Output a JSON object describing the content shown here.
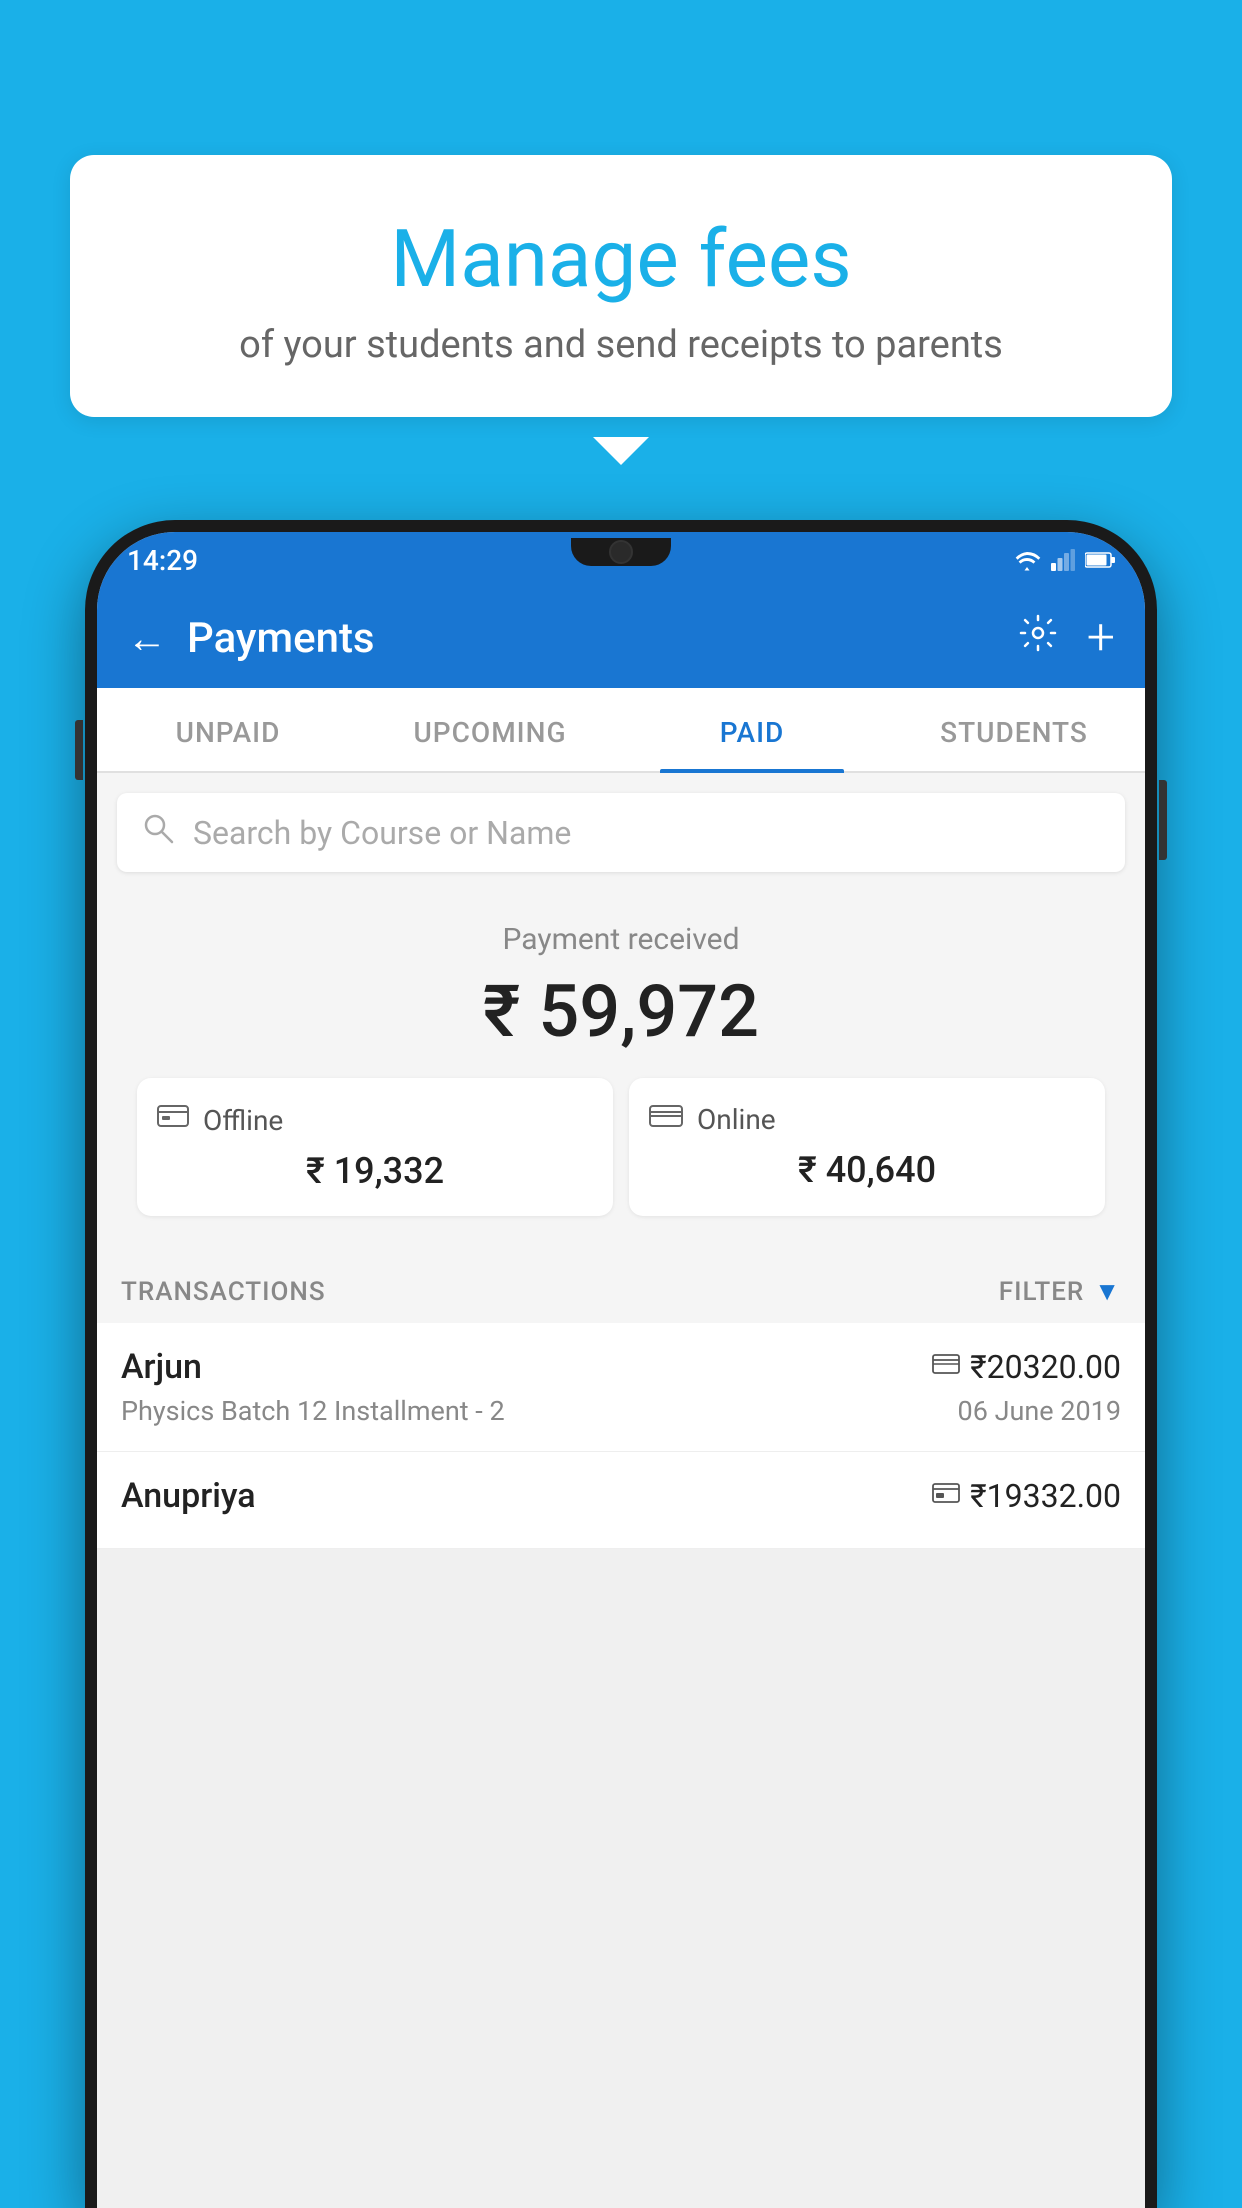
{
  "background_color": "#1AB0E8",
  "tooltip": {
    "title": "Manage fees",
    "subtitle": "of your students and send receipts to parents"
  },
  "status_bar": {
    "time": "14:29",
    "wifi_icon": "wifi",
    "signal_icon": "signal",
    "battery_icon": "battery"
  },
  "app_bar": {
    "title": "Payments",
    "back_icon": "←",
    "settings_icon": "⚙",
    "add_icon": "+"
  },
  "tabs": [
    {
      "label": "UNPAID",
      "active": false
    },
    {
      "label": "UPCOMING",
      "active": false
    },
    {
      "label": "PAID",
      "active": true
    },
    {
      "label": "STUDENTS",
      "active": false
    }
  ],
  "search": {
    "placeholder": "Search by Course or Name"
  },
  "payment_summary": {
    "label": "Payment received",
    "amount": "₹ 59,972"
  },
  "payment_cards": [
    {
      "type": "Offline",
      "amount": "₹ 19,332",
      "icon": "offline"
    },
    {
      "type": "Online",
      "amount": "₹ 40,640",
      "icon": "online"
    }
  ],
  "transactions_header": {
    "label": "TRANSACTIONS",
    "filter_label": "FILTER"
  },
  "transactions": [
    {
      "name": "Arjun",
      "description": "Physics Batch 12 Installment - 2",
      "amount": "₹20320.00",
      "date": "06 June 2019",
      "payment_type": "online"
    },
    {
      "name": "Anupriya",
      "description": "",
      "amount": "₹19332.00",
      "date": "",
      "payment_type": "offline"
    }
  ]
}
